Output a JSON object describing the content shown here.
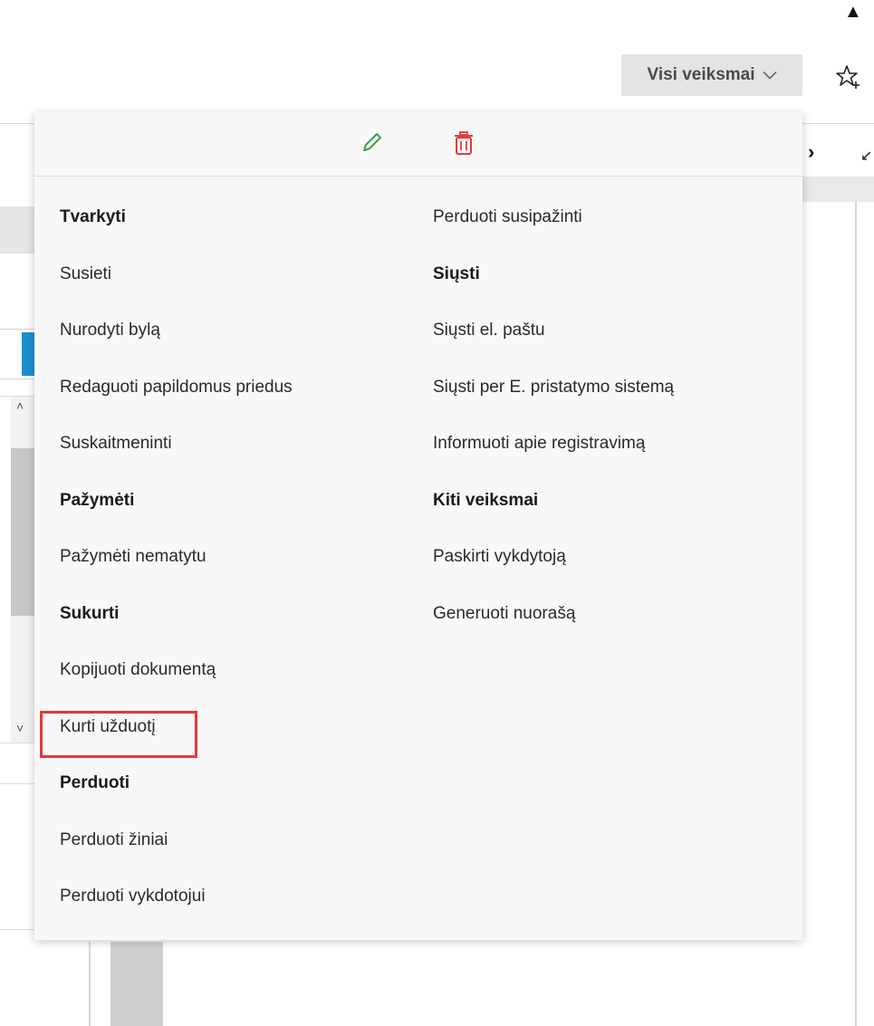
{
  "top_bar": {
    "actions_label": "Visi veiksmai",
    "actions_icon": "chevron-down-icon",
    "favorite_icon": "star-plus-icon"
  },
  "dropdown": {
    "toolbar": {
      "edit_icon": "pencil-icon",
      "edit_color": "#3aa04a",
      "delete_icon": "trash-icon",
      "delete_color": "#e53935"
    },
    "left_column": [
      {
        "type": "header",
        "label": "Tvarkyti"
      },
      {
        "type": "item",
        "label": "Susieti"
      },
      {
        "type": "item",
        "label": "Nurodyti bylą"
      },
      {
        "type": "item",
        "label": "Redaguoti papildomus priedus"
      },
      {
        "type": "item",
        "label": "Suskaitmeninti"
      },
      {
        "type": "header",
        "label": "Pažymėti"
      },
      {
        "type": "item",
        "label": "Pažymėti nematytu"
      },
      {
        "type": "header",
        "label": "Sukurti"
      },
      {
        "type": "item",
        "label": "Kopijuoti dokumentą"
      },
      {
        "type": "item",
        "label": "Kurti užduotį",
        "highlighted": true
      },
      {
        "type": "header",
        "label": "Perduoti"
      },
      {
        "type": "item",
        "label": "Perduoti žiniai"
      },
      {
        "type": "item",
        "label": "Perduoti vykdotojui"
      }
    ],
    "right_column": [
      {
        "type": "item",
        "label": "Perduoti susipažinti"
      },
      {
        "type": "header",
        "label": "Siųsti"
      },
      {
        "type": "item",
        "label": "Siųsti el. paštu"
      },
      {
        "type": "item",
        "label": "Siųsti per E. pristatymo sistemą"
      },
      {
        "type": "item",
        "label": "Informuoti apie registravimą"
      },
      {
        "type": "header",
        "label": "Kiti veiksmai"
      },
      {
        "type": "item",
        "label": "Paskirti vykdytoją"
      },
      {
        "type": "item",
        "label": "Generuoti nuorašą"
      }
    ],
    "highlight_color": "#e8363a"
  },
  "background": {
    "accent_color": "#1a8fd1"
  }
}
